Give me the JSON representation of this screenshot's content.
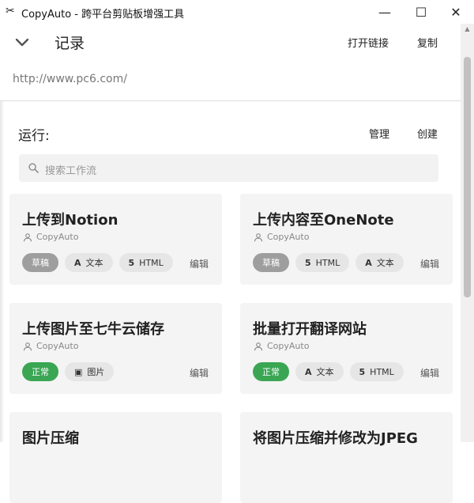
{
  "window": {
    "app_icon": "scissors-icon",
    "title": "CopyAuto - 跨平台剪贴板增强工具",
    "minimize": "—",
    "maximize": "☐",
    "close": "✕"
  },
  "record": {
    "title": "记录",
    "open_link": "打开链接",
    "copy": "复制",
    "url": "http://www.pc6.com/"
  },
  "run": {
    "title": "运行:",
    "manage": "管理",
    "create": "创建",
    "search_placeholder": "搜索工作流"
  },
  "cards": [
    {
      "title": "上传到Notion",
      "author": "CopyAuto",
      "status": "草稿",
      "tags": [
        {
          "icon": "A",
          "label": "文本"
        },
        {
          "icon": "5",
          "label": "HTML"
        }
      ],
      "edit": "编辑"
    },
    {
      "title": "上传内容至OneNote",
      "author": "CopyAuto",
      "status": "草稿",
      "tags": [
        {
          "icon": "5",
          "label": "HTML"
        },
        {
          "icon": "A",
          "label": "文本"
        }
      ],
      "edit": "编辑"
    },
    {
      "title": "上传图片至七牛云储存",
      "author": "CopyAuto",
      "status": "正常",
      "tags": [
        {
          "icon": "▣",
          "label": "图片"
        }
      ],
      "edit": "编辑"
    },
    {
      "title": "批量打开翻译网站",
      "author": "CopyAuto",
      "status": "正常",
      "tags": [
        {
          "icon": "A",
          "label": "文本"
        },
        {
          "icon": "5",
          "label": "HTML"
        }
      ],
      "edit": "编辑"
    },
    {
      "title": "图片压缩",
      "author": "",
      "status": "",
      "tags": [],
      "edit": ""
    },
    {
      "title": "将图片压缩并修改为JPEG",
      "author": "",
      "status": "",
      "tags": [],
      "edit": ""
    }
  ],
  "colors": {
    "status_draft": "#9e9e9e",
    "status_ok": "#3aa654",
    "card_bg": "#f4f4f4"
  }
}
